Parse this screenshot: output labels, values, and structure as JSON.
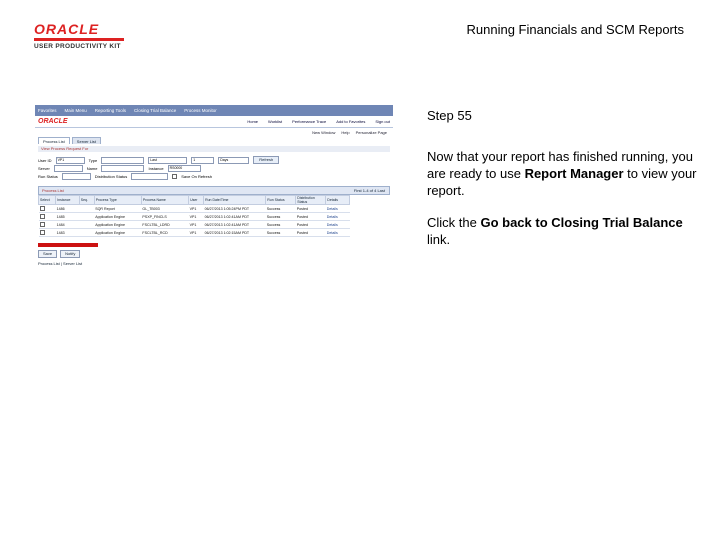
{
  "header": {
    "logo_top": "ORACLE",
    "logo_bottom": "USER PRODUCTIVITY KIT",
    "title": "Running Financials and SCM Reports"
  },
  "instructions": {
    "step": "Step 55",
    "p1_a": "Now that your report has finished running, you are ready to use ",
    "p1_b": "Report Manager",
    "p1_c": " to view your report.",
    "p2_a": "Click the ",
    "p2_b": "Go back to Closing Trial Balance",
    "p2_c": " link."
  },
  "screenshot": {
    "nav_items": [
      "Favorites",
      "Main Menu",
      "Reporting Tools",
      "Closing Trial Balance",
      "Process Monitor"
    ],
    "brand": "ORACLE",
    "top_links": [
      "Home",
      "Worklist",
      "Performance Trace",
      "Add to Favorites",
      "Sign out"
    ],
    "util_links": [
      "New Window",
      "Help",
      "Personalize Page"
    ],
    "tabs": [
      "Process List",
      "Server List"
    ],
    "crumb": "View Process Request For",
    "filters": {
      "row1": {
        "l1": "User ID",
        "v1": "VP1",
        "l2": "Type",
        "l3": "Last",
        "v3": "1",
        "v4": "Days",
        "btn": "Refresh"
      },
      "row2": {
        "l1": "Server",
        "l2": "Name",
        "l3": "Instance",
        "v3": "RS0000"
      },
      "row3": {
        "l1": "Run Status",
        "l2": "Distribution Status",
        "l3": "Save On Refresh"
      }
    },
    "list_title": "Process List",
    "pager": "First 1-4 of 4 Last",
    "columns": [
      "Select",
      "Instance",
      "Seq.",
      "Process Type",
      "Process Name",
      "User",
      "Run Date/Time",
      "Run Status",
      "Distribution Status",
      "Details"
    ],
    "rows": [
      [
        "1486",
        "",
        "SQR Report",
        "GL_TB003",
        "VP1",
        "06/27/2013 1:05:24PM PDT",
        "Success",
        "Posted",
        "Details"
      ],
      [
        "1485",
        "",
        "Application Engine",
        "PSXP_FINCLS",
        "VP1",
        "06/27/2013 1:02:41AM PDT",
        "Success",
        "Posted",
        "Details"
      ],
      [
        "1484",
        "",
        "Application Engine",
        "FSCLTBL_LDRD",
        "VP1",
        "06/27/2013 1:02:41AM PDT",
        "Success",
        "Posted",
        "Details"
      ],
      [
        "1483",
        "",
        "Application Engine",
        "FSCLTBL_RCD",
        "VP1",
        "06/27/2013 1:02:15AM PDT",
        "Success",
        "Posted",
        "Details"
      ]
    ],
    "buttons": [
      "Save",
      "Notify"
    ],
    "bottom_link": "Process List | Server List"
  }
}
